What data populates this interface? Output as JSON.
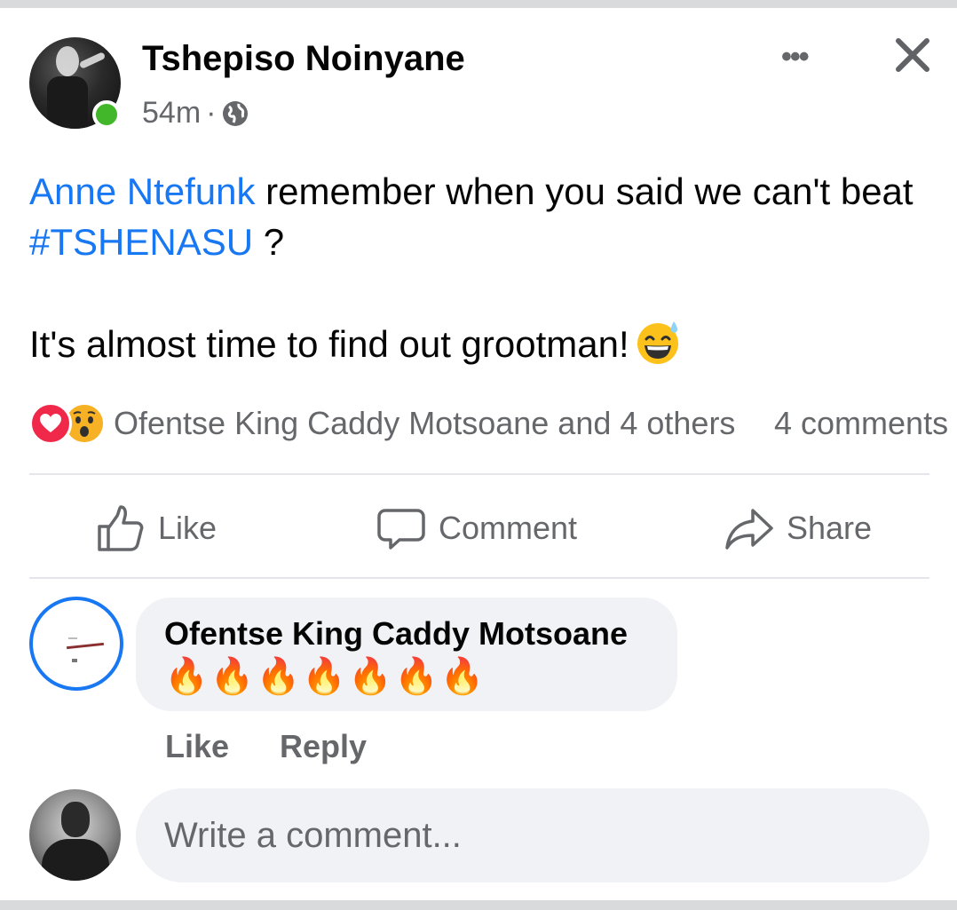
{
  "post": {
    "author": "Tshepiso Noinyane",
    "time": "54m",
    "separator": "·",
    "audience_icon": "globe-icon",
    "menu_icon": "more-options-icon",
    "close_icon": "close-icon",
    "mention": "Anne Ntefunk",
    "text_part1": " remember when you said we can't beat ",
    "hashtag": "#TSHENASU",
    "text_part2": " ?",
    "paragraph2": "It's almost time to find out grootman!",
    "paragraph2_emoji": "grinning-sweat-emoji"
  },
  "reactions": {
    "types": [
      "heart-reaction-icon",
      "wow-reaction-icon"
    ],
    "summary": "Ofentse King Caddy Motsoane and 4 others",
    "comments_count": "4 comments"
  },
  "actions": {
    "like": "Like",
    "comment": "Comment",
    "share": "Share"
  },
  "comments": [
    {
      "author": "Ofentse King Caddy Motsoane",
      "text": "🔥🔥🔥🔥🔥🔥🔥",
      "like_label": "Like",
      "reply_label": "Reply"
    }
  ],
  "composer": {
    "placeholder": "Write a comment..."
  },
  "colors": {
    "link": "#1877f2",
    "secondary_text": "#65676b",
    "online": "#42b72a",
    "bubble": "#f0f2f5"
  }
}
